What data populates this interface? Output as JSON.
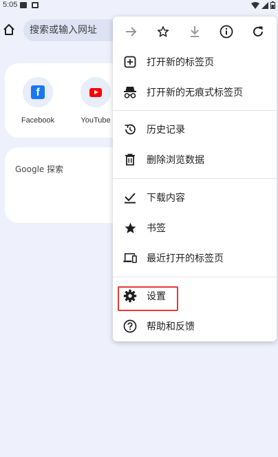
{
  "status_bar": {
    "time": "5:05"
  },
  "toolbar": {
    "omnibox_text": "搜索或输入网址"
  },
  "tiles": [
    {
      "label": "Facebook",
      "icon": "facebook-icon"
    },
    {
      "label": "YouTube",
      "icon": "youtube-icon"
    }
  ],
  "search_card": {
    "label": "Google 探索"
  },
  "menu": {
    "top_icons": [
      "forward-icon",
      "star-icon",
      "download-icon",
      "info-icon",
      "refresh-icon"
    ],
    "items": [
      {
        "label": "打开新的标签页",
        "icon": "new-tab-icon"
      },
      {
        "label": "打开新的无痕式标签页",
        "icon": "incognito-icon"
      },
      {
        "label": "历史记录",
        "icon": "history-icon"
      },
      {
        "label": "删除浏览数据",
        "icon": "trash-icon"
      },
      {
        "label": "下载内容",
        "icon": "downloads-icon"
      },
      {
        "label": "书签",
        "icon": "star-filled-icon"
      },
      {
        "label": "最近打开的标签页",
        "icon": "recent-tabs-icon"
      },
      {
        "label": "设置",
        "icon": "settings-gear-icon"
      },
      {
        "label": "帮助和反馈",
        "icon": "help-icon"
      }
    ]
  },
  "colors": {
    "highlight": "#e53935",
    "background": "#eef1fb",
    "omnibox": "#dde3f3"
  }
}
